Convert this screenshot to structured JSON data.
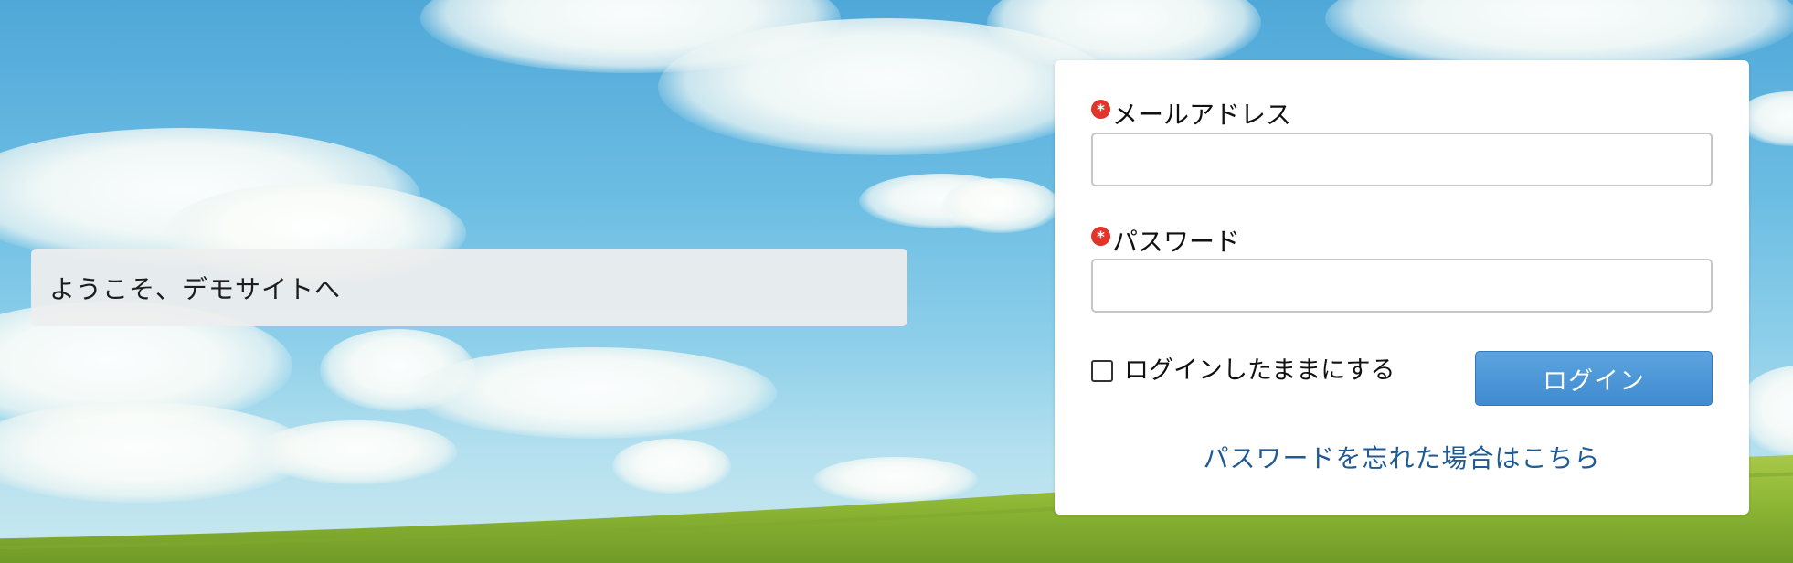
{
  "welcome": {
    "text": "ようこそ、デモサイトへ"
  },
  "login": {
    "email_label": "メールアドレス",
    "email_value": "",
    "password_label": "パスワード",
    "password_value": "",
    "required_marker": "*",
    "remember_label": "ログインしたままにする",
    "remember_checked": false,
    "submit_label": "ログイン",
    "forgot_link": "パスワードを忘れた場合はこちら"
  },
  "colors": {
    "required_marker": "#e0352b",
    "button": "#4a95d6",
    "link": "#1e5a96",
    "panel": "#ffffff"
  }
}
